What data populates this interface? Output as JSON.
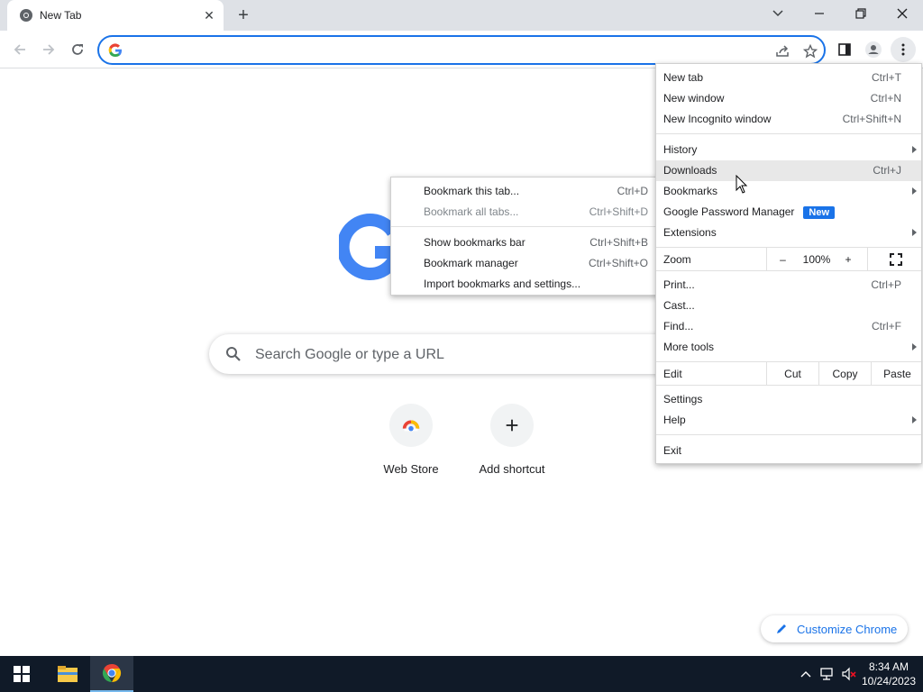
{
  "tab": {
    "title": "New Tab"
  },
  "ntp": {
    "search_placeholder": "Search Google or type a URL",
    "shortcuts": [
      {
        "label": "Web Store"
      },
      {
        "label": "Add shortcut"
      }
    ],
    "customize_label": "Customize Chrome"
  },
  "chrome_menu": {
    "new_tab": {
      "label": "New tab",
      "shortcut": "Ctrl+T"
    },
    "new_window": {
      "label": "New window",
      "shortcut": "Ctrl+N"
    },
    "new_incognito": {
      "label": "New Incognito window",
      "shortcut": "Ctrl+Shift+N"
    },
    "history": {
      "label": "History"
    },
    "downloads": {
      "label": "Downloads",
      "shortcut": "Ctrl+J"
    },
    "bookmarks": {
      "label": "Bookmarks"
    },
    "password_manager": {
      "label": "Google Password Manager",
      "badge": "New"
    },
    "extensions": {
      "label": "Extensions"
    },
    "zoom": {
      "label": "Zoom",
      "minus": "–",
      "level": "100%",
      "plus": "+"
    },
    "print": {
      "label": "Print...",
      "shortcut": "Ctrl+P"
    },
    "cast": {
      "label": "Cast..."
    },
    "find": {
      "label": "Find...",
      "shortcut": "Ctrl+F"
    },
    "more_tools": {
      "label": "More tools"
    },
    "edit": {
      "label": "Edit",
      "cut": "Cut",
      "copy": "Copy",
      "paste": "Paste"
    },
    "settings": {
      "label": "Settings"
    },
    "help": {
      "label": "Help"
    },
    "exit": {
      "label": "Exit"
    }
  },
  "bookmarks_menu": {
    "bookmark_tab": {
      "label": "Bookmark this tab...",
      "shortcut": "Ctrl+D"
    },
    "bookmark_all": {
      "label": "Bookmark all tabs...",
      "shortcut": "Ctrl+Shift+D"
    },
    "show_bar": {
      "label": "Show bookmarks bar",
      "shortcut": "Ctrl+Shift+B"
    },
    "manager": {
      "label": "Bookmark manager",
      "shortcut": "Ctrl+Shift+O"
    },
    "import": {
      "label": "Import bookmarks and settings..."
    }
  },
  "taskbar": {
    "time": "8:34 AM",
    "date": "10/24/2023"
  },
  "colors": {
    "accent": "#1a73e8",
    "tabstrip": "#dee1e6",
    "taskbar": "#101a28"
  }
}
